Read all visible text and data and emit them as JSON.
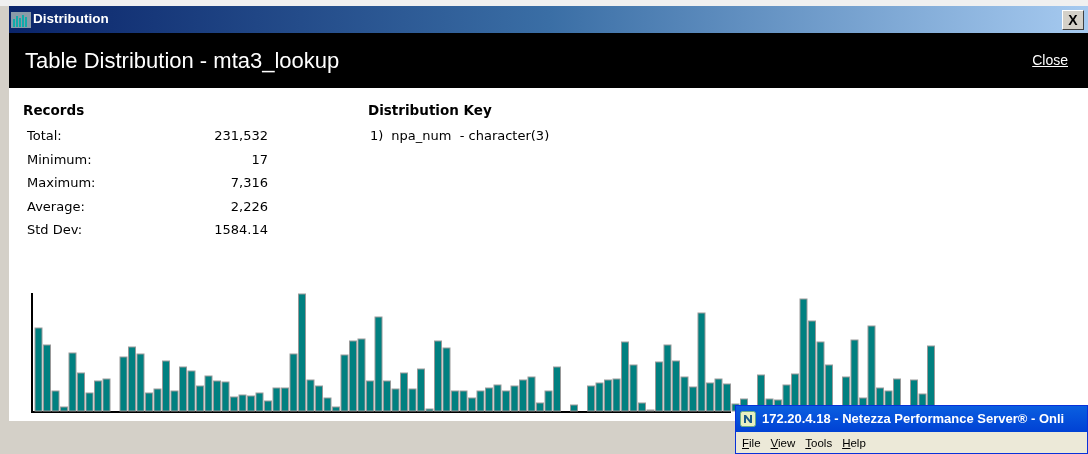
{
  "window": {
    "title": "Distribution",
    "close_symbol": "X"
  },
  "header": {
    "title": "Table Distribution - mta3_lookup",
    "close_link": "Close"
  },
  "records": {
    "heading": "Records",
    "rows": [
      {
        "label": "Total:",
        "value": "231,532"
      },
      {
        "label": "Minimum:",
        "value": "17"
      },
      {
        "label": "Maximum:",
        "value": "7,316"
      },
      {
        "label": "Average:",
        "value": "2,226"
      },
      {
        "label": "Std Dev:",
        "value": "1584.14"
      }
    ]
  },
  "distribution_key": {
    "heading": "Distribution Key",
    "items": [
      {
        "number": "1)",
        "text": "npa_num  - character(3)"
      }
    ]
  },
  "background_window": {
    "title": "172.20.4.18  - Netezza Performance Server® - Onli",
    "menu": [
      "File",
      "View",
      "Tools",
      "Help"
    ]
  }
}
